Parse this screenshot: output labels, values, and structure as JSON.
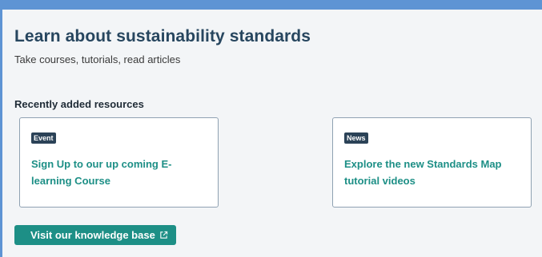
{
  "header": {
    "title": "Learn about sustainability standards",
    "subtitle": "Take courses, tutorials, read articles"
  },
  "resources": {
    "heading": "Recently added resources",
    "cards": [
      {
        "badge": "Event",
        "title": "Sign Up to our up coming E-learning Course"
      },
      {
        "badge": "News",
        "title": "Explore the new Standards Map tutorial videos"
      }
    ]
  },
  "knowledge_base_button": {
    "label": "Visit our knowledge base",
    "icon": "external-link-icon"
  },
  "colors": {
    "frame": "#5e94d4",
    "background": "#f3f5f7",
    "title": "#27465f",
    "accent": "#1d8f86",
    "badge": "#2b4257",
    "card_border": "#8fa1b2"
  }
}
